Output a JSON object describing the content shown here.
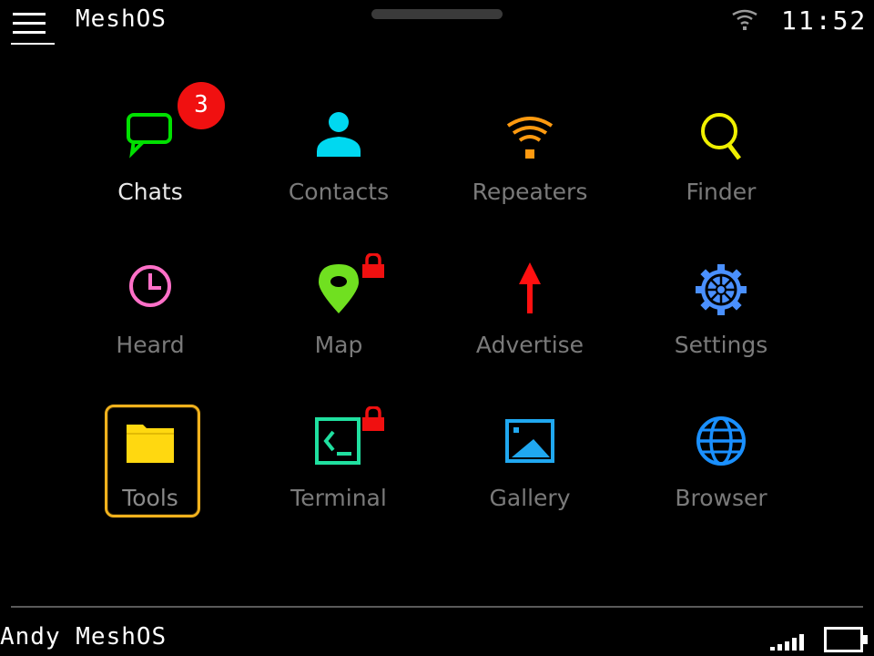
{
  "status_bar": {
    "app_title": "MeshOS",
    "clock": "11:52",
    "menu_icon": "hamburger-menu-icon",
    "wifi_icon": "wifi-icon"
  },
  "apps": [
    {
      "label": "Chats",
      "icon": "chat-bubble-icon",
      "color": "#00e000",
      "badge": "3"
    },
    {
      "label": "Contacts",
      "icon": "person-icon",
      "color": "#00d8f0"
    },
    {
      "label": "Repeaters",
      "icon": "broadcast-icon",
      "color": "#ff9a10"
    },
    {
      "label": "Finder",
      "icon": "magnifier-icon",
      "color": "#f0f000"
    },
    {
      "label": "Heard",
      "icon": "clock-icon",
      "color": "#ff70c8"
    },
    {
      "label": "Map",
      "icon": "map-pin-icon",
      "color": "#70e020",
      "locked": true
    },
    {
      "label": "Advertise",
      "icon": "arrow-up-icon",
      "color": "#ff1010"
    },
    {
      "label": "Settings",
      "icon": "gear-icon",
      "color": "#4a90ff"
    },
    {
      "label": "Tools",
      "icon": "folder-icon",
      "color": "#ffd810"
    },
    {
      "label": "Terminal",
      "icon": "terminal-icon",
      "color": "#20e0a0",
      "locked": true
    },
    {
      "label": "Gallery",
      "icon": "image-icon",
      "color": "#20a8f0"
    },
    {
      "label": "Browser",
      "icon": "globe-icon",
      "color": "#1a90ff"
    }
  ],
  "selection": {
    "focused_app": "Tools",
    "focus_color": "#f1b21d"
  },
  "lock_color": "#f01010",
  "footer": {
    "device_name": "Andy MeshOS",
    "signal_icon": "signal-bars-icon",
    "battery_icon": "battery-icon"
  }
}
